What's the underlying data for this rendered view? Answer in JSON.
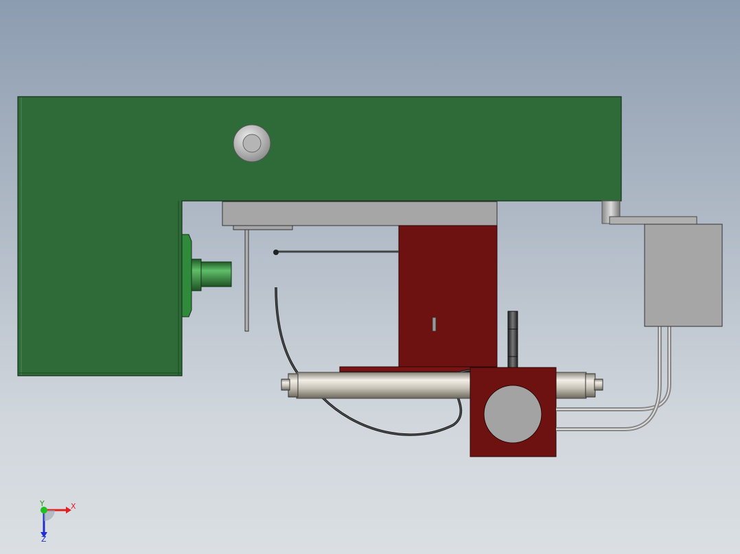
{
  "viewport": {
    "background_top": "#8c9cb0",
    "background_bottom": "#dadfe3"
  },
  "model": {
    "bracket_color": "#2e6b38",
    "block_color": "#6e1111",
    "steel_color": "#a3a3a3",
    "rod_color": "#c9c4b8"
  },
  "triad": {
    "x_label": "X",
    "y_label": "Y",
    "z_label": "Z",
    "x_color": "#e02020",
    "y_color": "#20c020",
    "z_color": "#2030d0"
  }
}
